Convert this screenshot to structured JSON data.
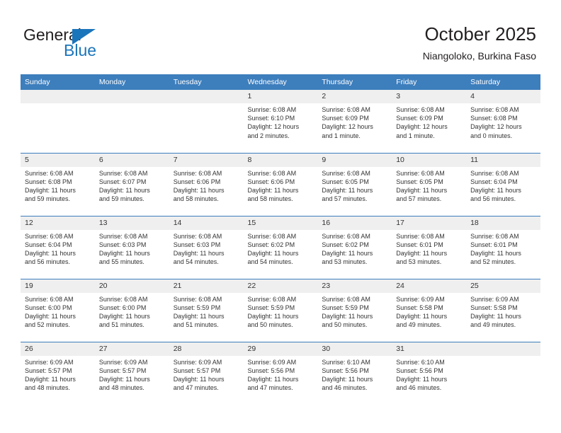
{
  "brand": {
    "name_part1": "General",
    "name_part2": "Blue",
    "triangle_color": "#1b75bb",
    "text_color": "#231f20"
  },
  "header": {
    "title": "October 2025",
    "subtitle": "Niangoloko, Burkina Faso"
  },
  "colors": {
    "header_blue": "#3d7ebd",
    "daynum_bg": "#efefef",
    "text": "#333333"
  },
  "weekdays": [
    "Sunday",
    "Monday",
    "Tuesday",
    "Wednesday",
    "Thursday",
    "Friday",
    "Saturday"
  ],
  "labels": {
    "sunrise": "Sunrise:",
    "sunset": "Sunset:",
    "daylight": "Daylight:"
  },
  "weeks": [
    [
      {
        "day": "",
        "empty": true
      },
      {
        "day": "",
        "empty": true
      },
      {
        "day": "",
        "empty": true
      },
      {
        "day": "1",
        "sunrise": "Sunrise: 6:08 AM",
        "sunset": "Sunset: 6:10 PM",
        "daylight1": "Daylight: 12 hours",
        "daylight2": "and 2 minutes."
      },
      {
        "day": "2",
        "sunrise": "Sunrise: 6:08 AM",
        "sunset": "Sunset: 6:09 PM",
        "daylight1": "Daylight: 12 hours",
        "daylight2": "and 1 minute."
      },
      {
        "day": "3",
        "sunrise": "Sunrise: 6:08 AM",
        "sunset": "Sunset: 6:09 PM",
        "daylight1": "Daylight: 12 hours",
        "daylight2": "and 1 minute."
      },
      {
        "day": "4",
        "sunrise": "Sunrise: 6:08 AM",
        "sunset": "Sunset: 6:08 PM",
        "daylight1": "Daylight: 12 hours",
        "daylight2": "and 0 minutes."
      }
    ],
    [
      {
        "day": "5",
        "sunrise": "Sunrise: 6:08 AM",
        "sunset": "Sunset: 6:08 PM",
        "daylight1": "Daylight: 11 hours",
        "daylight2": "and 59 minutes."
      },
      {
        "day": "6",
        "sunrise": "Sunrise: 6:08 AM",
        "sunset": "Sunset: 6:07 PM",
        "daylight1": "Daylight: 11 hours",
        "daylight2": "and 59 minutes."
      },
      {
        "day": "7",
        "sunrise": "Sunrise: 6:08 AM",
        "sunset": "Sunset: 6:06 PM",
        "daylight1": "Daylight: 11 hours",
        "daylight2": "and 58 minutes."
      },
      {
        "day": "8",
        "sunrise": "Sunrise: 6:08 AM",
        "sunset": "Sunset: 6:06 PM",
        "daylight1": "Daylight: 11 hours",
        "daylight2": "and 58 minutes."
      },
      {
        "day": "9",
        "sunrise": "Sunrise: 6:08 AM",
        "sunset": "Sunset: 6:05 PM",
        "daylight1": "Daylight: 11 hours",
        "daylight2": "and 57 minutes."
      },
      {
        "day": "10",
        "sunrise": "Sunrise: 6:08 AM",
        "sunset": "Sunset: 6:05 PM",
        "daylight1": "Daylight: 11 hours",
        "daylight2": "and 57 minutes."
      },
      {
        "day": "11",
        "sunrise": "Sunrise: 6:08 AM",
        "sunset": "Sunset: 6:04 PM",
        "daylight1": "Daylight: 11 hours",
        "daylight2": "and 56 minutes."
      }
    ],
    [
      {
        "day": "12",
        "sunrise": "Sunrise: 6:08 AM",
        "sunset": "Sunset: 6:04 PM",
        "daylight1": "Daylight: 11 hours",
        "daylight2": "and 56 minutes."
      },
      {
        "day": "13",
        "sunrise": "Sunrise: 6:08 AM",
        "sunset": "Sunset: 6:03 PM",
        "daylight1": "Daylight: 11 hours",
        "daylight2": "and 55 minutes."
      },
      {
        "day": "14",
        "sunrise": "Sunrise: 6:08 AM",
        "sunset": "Sunset: 6:03 PM",
        "daylight1": "Daylight: 11 hours",
        "daylight2": "and 54 minutes."
      },
      {
        "day": "15",
        "sunrise": "Sunrise: 6:08 AM",
        "sunset": "Sunset: 6:02 PM",
        "daylight1": "Daylight: 11 hours",
        "daylight2": "and 54 minutes."
      },
      {
        "day": "16",
        "sunrise": "Sunrise: 6:08 AM",
        "sunset": "Sunset: 6:02 PM",
        "daylight1": "Daylight: 11 hours",
        "daylight2": "and 53 minutes."
      },
      {
        "day": "17",
        "sunrise": "Sunrise: 6:08 AM",
        "sunset": "Sunset: 6:01 PM",
        "daylight1": "Daylight: 11 hours",
        "daylight2": "and 53 minutes."
      },
      {
        "day": "18",
        "sunrise": "Sunrise: 6:08 AM",
        "sunset": "Sunset: 6:01 PM",
        "daylight1": "Daylight: 11 hours",
        "daylight2": "and 52 minutes."
      }
    ],
    [
      {
        "day": "19",
        "sunrise": "Sunrise: 6:08 AM",
        "sunset": "Sunset: 6:00 PM",
        "daylight1": "Daylight: 11 hours",
        "daylight2": "and 52 minutes."
      },
      {
        "day": "20",
        "sunrise": "Sunrise: 6:08 AM",
        "sunset": "Sunset: 6:00 PM",
        "daylight1": "Daylight: 11 hours",
        "daylight2": "and 51 minutes."
      },
      {
        "day": "21",
        "sunrise": "Sunrise: 6:08 AM",
        "sunset": "Sunset: 5:59 PM",
        "daylight1": "Daylight: 11 hours",
        "daylight2": "and 51 minutes."
      },
      {
        "day": "22",
        "sunrise": "Sunrise: 6:08 AM",
        "sunset": "Sunset: 5:59 PM",
        "daylight1": "Daylight: 11 hours",
        "daylight2": "and 50 minutes."
      },
      {
        "day": "23",
        "sunrise": "Sunrise: 6:08 AM",
        "sunset": "Sunset: 5:59 PM",
        "daylight1": "Daylight: 11 hours",
        "daylight2": "and 50 minutes."
      },
      {
        "day": "24",
        "sunrise": "Sunrise: 6:09 AM",
        "sunset": "Sunset: 5:58 PM",
        "daylight1": "Daylight: 11 hours",
        "daylight2": "and 49 minutes."
      },
      {
        "day": "25",
        "sunrise": "Sunrise: 6:09 AM",
        "sunset": "Sunset: 5:58 PM",
        "daylight1": "Daylight: 11 hours",
        "daylight2": "and 49 minutes."
      }
    ],
    [
      {
        "day": "26",
        "sunrise": "Sunrise: 6:09 AM",
        "sunset": "Sunset: 5:57 PM",
        "daylight1": "Daylight: 11 hours",
        "daylight2": "and 48 minutes."
      },
      {
        "day": "27",
        "sunrise": "Sunrise: 6:09 AM",
        "sunset": "Sunset: 5:57 PM",
        "daylight1": "Daylight: 11 hours",
        "daylight2": "and 48 minutes."
      },
      {
        "day": "28",
        "sunrise": "Sunrise: 6:09 AM",
        "sunset": "Sunset: 5:57 PM",
        "daylight1": "Daylight: 11 hours",
        "daylight2": "and 47 minutes."
      },
      {
        "day": "29",
        "sunrise": "Sunrise: 6:09 AM",
        "sunset": "Sunset: 5:56 PM",
        "daylight1": "Daylight: 11 hours",
        "daylight2": "and 47 minutes."
      },
      {
        "day": "30",
        "sunrise": "Sunrise: 6:10 AM",
        "sunset": "Sunset: 5:56 PM",
        "daylight1": "Daylight: 11 hours",
        "daylight2": "and 46 minutes."
      },
      {
        "day": "31",
        "sunrise": "Sunrise: 6:10 AM",
        "sunset": "Sunset: 5:56 PM",
        "daylight1": "Daylight: 11 hours",
        "daylight2": "and 46 minutes."
      },
      {
        "day": "",
        "empty": true
      }
    ]
  ]
}
